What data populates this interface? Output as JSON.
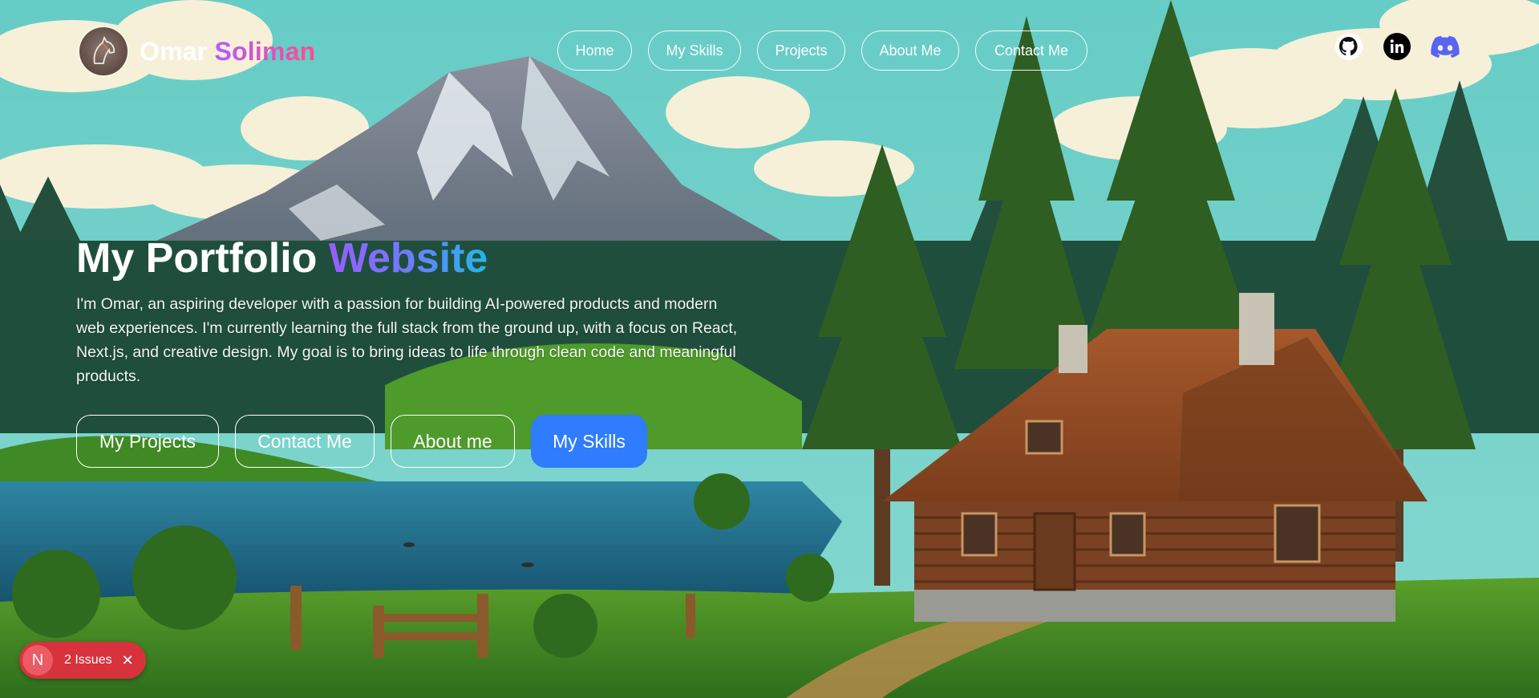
{
  "brand": {
    "first_name": "Omar",
    "last_name": "Soliman",
    "logo": "horse-avatar-icon"
  },
  "nav": {
    "items": [
      {
        "label": "Home"
      },
      {
        "label": "My Skills"
      },
      {
        "label": "Projects"
      },
      {
        "label": "About Me"
      },
      {
        "label": "Contact Me"
      }
    ]
  },
  "socials": [
    {
      "icon": "github-icon"
    },
    {
      "icon": "linkedin-icon"
    },
    {
      "icon": "discord-icon"
    }
  ],
  "hero": {
    "title_main": "My Portfolio",
    "title_accent": "Website",
    "description": "I'm Omar, an aspiring developer with a passion for building AI-powered products and modern web experiences. I'm currently learning the full stack from the ground up, with a focus on React, Next.js, and creative design. My goal is to bring ideas to life through clean code and meaningful products.",
    "buttons": [
      {
        "label": "My Projects"
      },
      {
        "label": "Contact Me"
      },
      {
        "label": "About me"
      },
      {
        "label": "My Skills"
      }
    ]
  },
  "dev_overlay": {
    "badge_letter": "N",
    "issues_label": "2 Issues"
  },
  "colors": {
    "primary_button": "#2f7cff",
    "issues_badge": "#d8323c",
    "sky": "#6ecfc8"
  }
}
